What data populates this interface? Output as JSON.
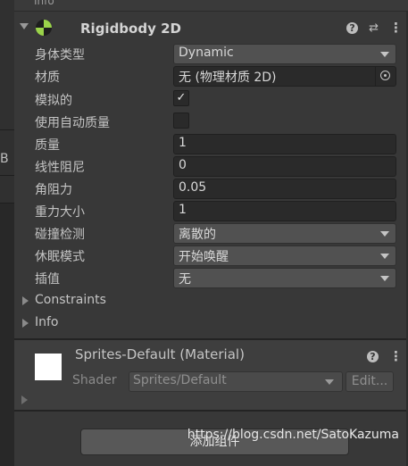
{
  "inspector": {
    "above_label": "Info",
    "left_glyph": "B",
    "component": {
      "title": "Rigidbody 2D",
      "help_icon": "question-circle-icon",
      "settings_icon": "preset-sliders-icon",
      "more_icon": "kebab-menu-icon",
      "fields": [
        {
          "label": "身体类型",
          "type": "dropdown",
          "value": "Dynamic"
        },
        {
          "label": "材质",
          "type": "object",
          "value": "无 (物理材质 2D)"
        },
        {
          "label": "模拟的",
          "type": "checkbox",
          "value": "✓",
          "checked": true
        },
        {
          "label": "使用自动质量",
          "type": "checkbox",
          "value": "",
          "checked": false
        },
        {
          "label": "质量",
          "type": "number",
          "value": "1"
        },
        {
          "label": "线性阻尼",
          "type": "number",
          "value": "0"
        },
        {
          "label": "角阻力",
          "type": "number",
          "value": "0.05"
        },
        {
          "label": "重力大小",
          "type": "number",
          "value": "1"
        },
        {
          "label": "碰撞检测",
          "type": "dropdown",
          "value": "离散的"
        },
        {
          "label": "休眠模式",
          "type": "dropdown",
          "value": "开始唤醒"
        },
        {
          "label": "插值",
          "type": "dropdown",
          "value": "无"
        }
      ],
      "foldouts": [
        "Constraints",
        "Info"
      ]
    },
    "material": {
      "name": "Sprites-Default (Material)",
      "shader_label": "Shader",
      "shader_value": "Sprites/Default",
      "edit_label": "Edit..."
    },
    "add_component_label": "添加组件",
    "watermark": "https://blog.csdn.net/SatoKazuma"
  }
}
